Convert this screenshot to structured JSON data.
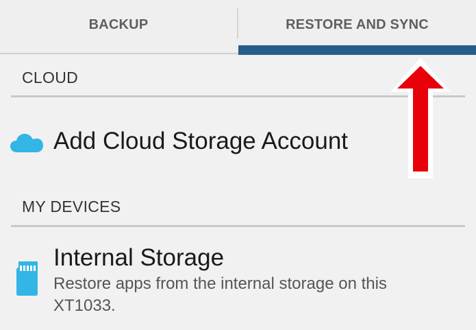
{
  "tabs": {
    "backup_label": "BACKUP",
    "restore_label": "RESTORE AND SYNC",
    "selected": "RESTORE AND SYNC"
  },
  "cloud": {
    "header": "CLOUD",
    "add_account_label": "Add Cloud Storage Account",
    "icon": "cloud-icon"
  },
  "devices": {
    "header": "MY DEVICES",
    "items": [
      {
        "title": "Internal Storage",
        "description": "Restore apps from the internal storage on this XT1033.",
        "icon": "sd-card-icon"
      }
    ]
  },
  "colors": {
    "accent": "#275d8c",
    "icon_blue": "#33b5e5",
    "annotation_arrow": "#e8000b"
  },
  "annotation": {
    "icon": "red-arrow-annotation"
  }
}
